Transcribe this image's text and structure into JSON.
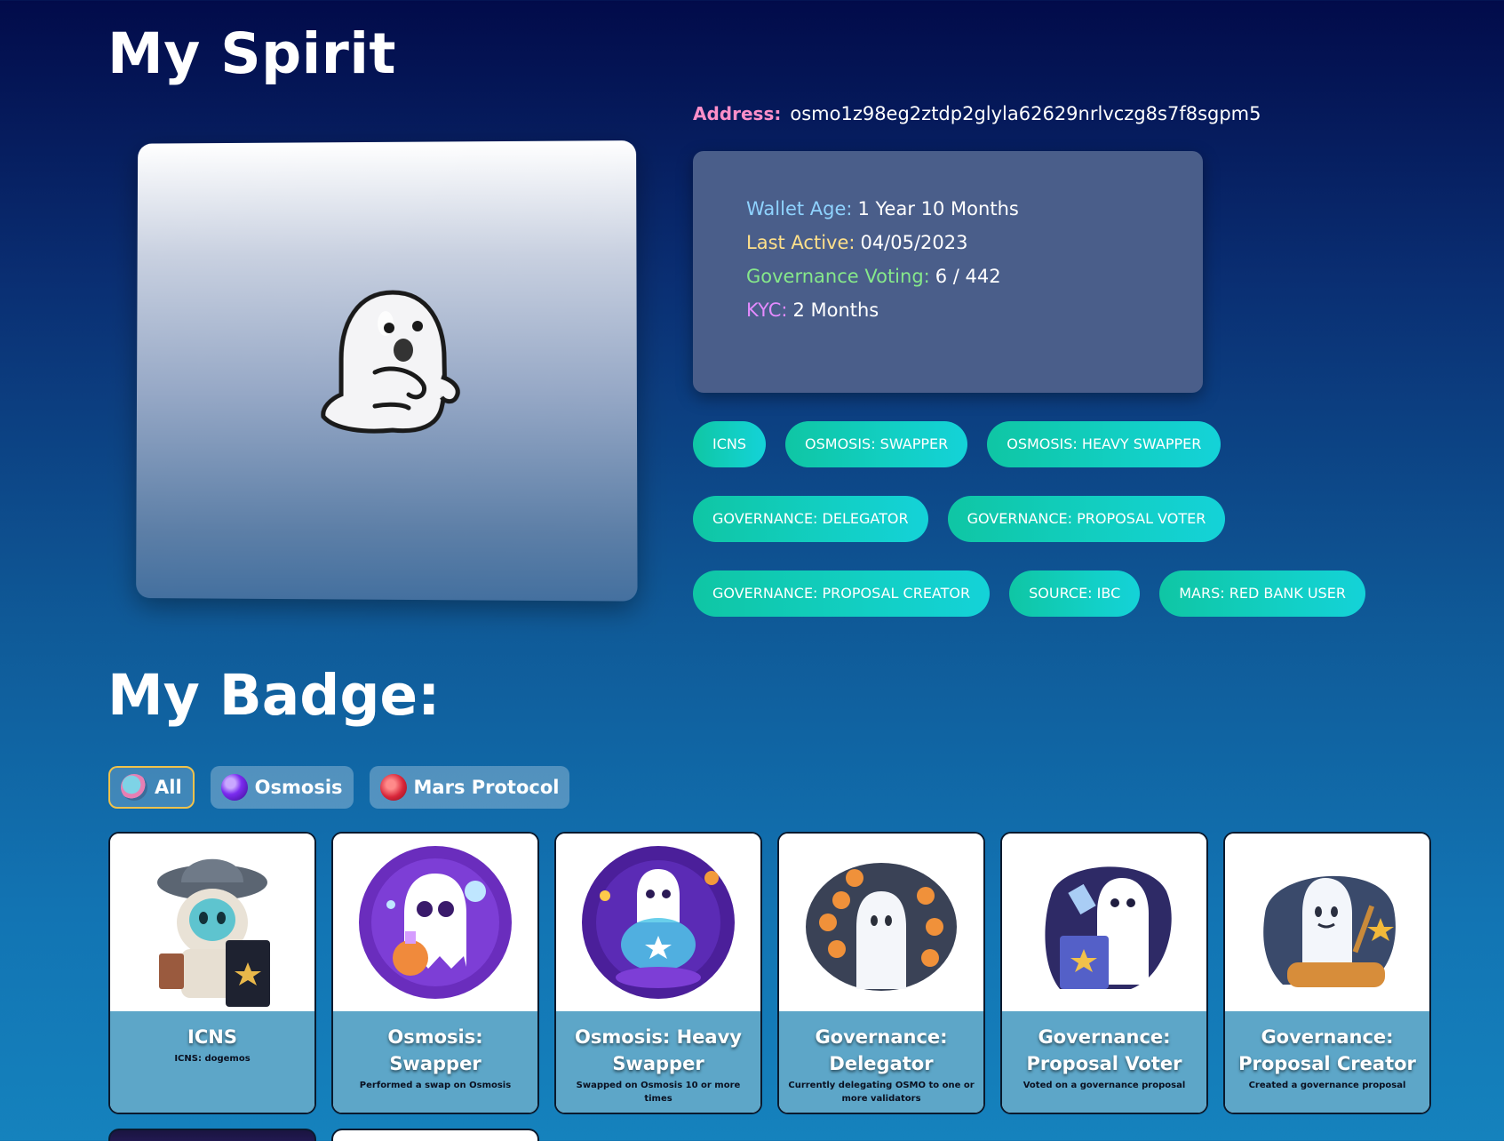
{
  "page": {
    "title": "My Spirit"
  },
  "address": {
    "label": "Address:",
    "value": "osmo1z98eg2ztdp2glyla62629nrlvczg8s7f8sgpm5"
  },
  "stats": [
    {
      "label": "Wallet Age:",
      "value": "1 Year 10 Months",
      "color": "#8fd3ff"
    },
    {
      "label": "Last Active:",
      "value": "04/05/2023",
      "color": "#ffe08a"
    },
    {
      "label": "Governance Voting:",
      "value": "6 / 442",
      "color": "#86e88a"
    },
    {
      "label": "KYC:",
      "value": "2 Months",
      "color": "#e48bff"
    }
  ],
  "tags": [
    "ICNS",
    "OSMOSIS: SWAPPER",
    "OSMOSIS: HEAVY SWAPPER",
    "GOVERNANCE: DELEGATOR",
    "GOVERNANCE: PROPOSAL VOTER",
    "GOVERNANCE: PROPOSAL CREATOR",
    "SOURCE: IBC",
    "MARS: RED BANK USER"
  ],
  "badges_section": {
    "title": "My Badge:",
    "filters": [
      {
        "label": "All",
        "active": true,
        "icon": "ghost-avatar-icon"
      },
      {
        "label": "Osmosis",
        "active": false,
        "icon": "osmosis-logo-icon"
      },
      {
        "label": "Mars Protocol",
        "active": false,
        "icon": "mars-logo-icon"
      }
    ]
  },
  "badges": [
    {
      "title": "ICNS",
      "description": "ICNS: dogemos",
      "icon": "wizard-ghost-icon"
    },
    {
      "title": "Osmosis: Swapper",
      "description": "Performed a swap on Osmosis",
      "icon": "potion-ghost-icon"
    },
    {
      "title": "Osmosis: Heavy Swapper",
      "description": "Swapped on Osmosis 10 or more times",
      "icon": "orb-ghost-icon"
    },
    {
      "title": "Governance: Delegator",
      "description": "Currently delegating OSMO to one or more validators",
      "icon": "validator-ghost-icon"
    },
    {
      "title": "Governance: Proposal Voter",
      "description": "Voted on a governance proposal",
      "icon": "ballot-ghost-icon"
    },
    {
      "title": "Governance: Proposal Creator",
      "description": "Created a governance proposal",
      "icon": "scroll-ghost-icon"
    }
  ]
}
